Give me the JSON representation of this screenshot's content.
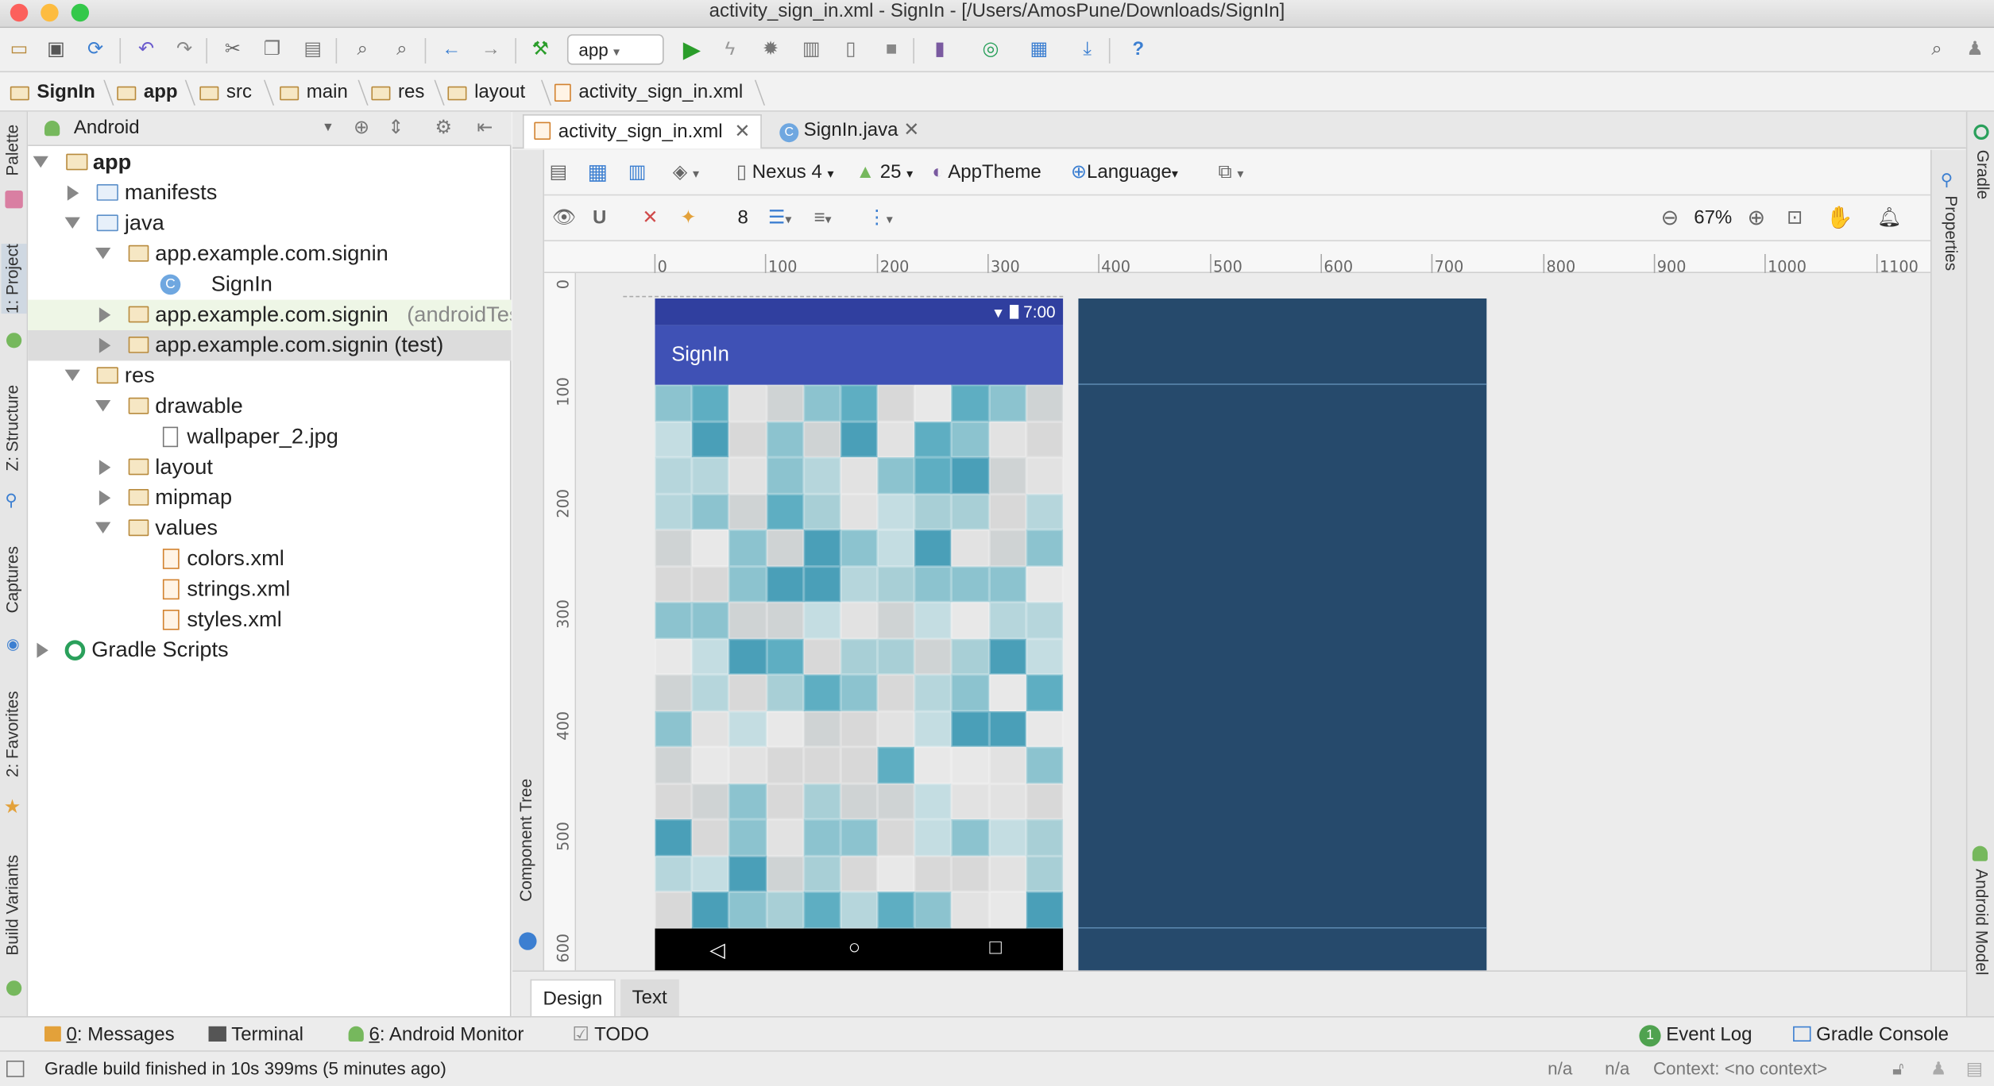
{
  "window": {
    "title": "activity_sign_in.xml - SignIn - [/Users/AmosPune/Downloads/SignIn]"
  },
  "toolbar": {
    "run_config": "app",
    "icons": [
      "open-folder-icon",
      "save-icon",
      "sync-icon",
      "undo-icon",
      "redo-icon",
      "cut-icon",
      "copy-icon",
      "paste-icon",
      "find-icon",
      "replace-icon",
      "back-icon",
      "forward-icon",
      "make-project-icon",
      "run-icon",
      "instant-run-icon",
      "debug-icon",
      "profile-icon",
      "attach-debugger-icon",
      "stop-icon",
      "avd-manager-icon",
      "sync-gradle-icon",
      "project-structure-icon",
      "sdk-manager-icon",
      "help-icon",
      "search-everywhere-icon"
    ]
  },
  "breadcrumbs": [
    "SignIn",
    "app",
    "src",
    "main",
    "res",
    "layout",
    "activity_sign_in.xml"
  ],
  "left_strip": [
    "Palette",
    "1: Project",
    "Z: Structure",
    "Captures",
    "2: Favorites",
    "Build Variants"
  ],
  "right_strip": [
    "Gradle",
    "Properties",
    "Android Model"
  ],
  "project": {
    "view_selector": "Android",
    "tree": [
      {
        "label": "app",
        "bold": true
      },
      {
        "label": "manifests"
      },
      {
        "label": "java"
      },
      {
        "label": "app.example.com.signin"
      },
      {
        "label": "SignIn"
      },
      {
        "label": "app.example.com.signin",
        "suffix": "(androidTest)"
      },
      {
        "label": "app.example.com.signin (test)"
      },
      {
        "label": "res"
      },
      {
        "label": "drawable"
      },
      {
        "label": "wallpaper_2.jpg"
      },
      {
        "label": "layout"
      },
      {
        "label": "mipmap"
      },
      {
        "label": "values"
      },
      {
        "label": "colors.xml"
      },
      {
        "label": "strings.xml"
      },
      {
        "label": "styles.xml"
      },
      {
        "label": "Gradle Scripts"
      }
    ]
  },
  "editor_tabs": [
    {
      "label": "activity_sign_in.xml",
      "active": true
    },
    {
      "label": "SignIn.java",
      "active": false
    }
  ],
  "designer": {
    "device": "Nexus 4",
    "api": "25",
    "theme": "AppTheme",
    "language": "Language",
    "margin": "8",
    "zoom": "67%",
    "component_tree_label": "Component Tree",
    "ruler_h": [
      "0",
      "100",
      "200",
      "300",
      "400",
      "500",
      "600",
      "700",
      "800",
      "900",
      "1000",
      "1100"
    ],
    "ruler_v": [
      "0",
      "100",
      "200",
      "300",
      "400",
      "500",
      "600"
    ]
  },
  "phone": {
    "time": "7:00",
    "app_title": "SignIn"
  },
  "bottom_tabs": [
    {
      "label": "Design",
      "active": true
    },
    {
      "label": "Text",
      "active": false
    }
  ],
  "tool_windows": {
    "messages": {
      "num": "0",
      "label": ": Messages"
    },
    "terminal": "Terminal",
    "android_monitor": {
      "num": "6",
      "label": ": Android Monitor"
    },
    "todo": "TODO",
    "event_log": {
      "badge": "1",
      "label": "Event Log"
    },
    "gradle_console": "Gradle Console"
  },
  "status": {
    "message": "Gradle build finished in 10s 399ms (5 minutes ago)",
    "na1": "n/a",
    "na2": "n/a",
    "context": "Context: <no context>"
  },
  "colors": {
    "primary_dark": "#303f9f",
    "primary": "#3f51b5",
    "blueprint": "#264a6c",
    "run_green": "#2a9d2a"
  }
}
